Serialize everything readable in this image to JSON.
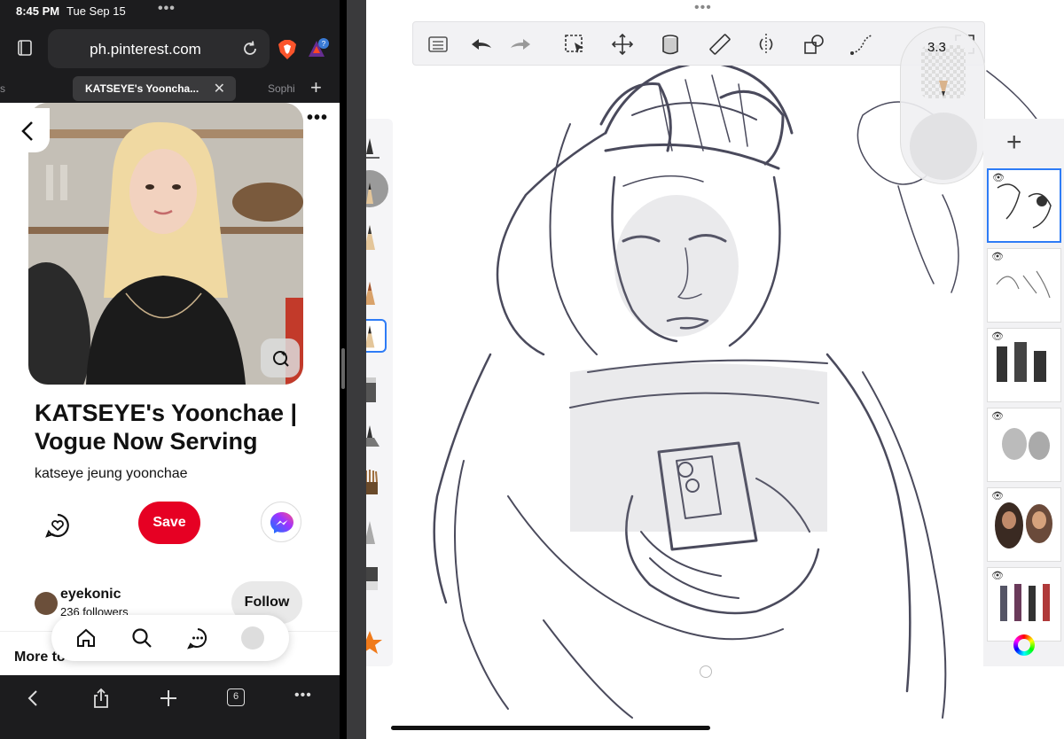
{
  "status_bar": {
    "time": "8:45 PM",
    "date": "Tue Sep 15"
  },
  "browser": {
    "url": "ph.pinterest.com",
    "tabs": [
      {
        "label": "KATSEYE's Yooncha...",
        "active": true
      },
      {
        "label": "Sophi",
        "active": false
      }
    ],
    "bat_badge": "?",
    "tab_count": "6"
  },
  "pin": {
    "title": "KATSEYE's Yoonchae | Vogue Now Serving",
    "description": "katseye jeung yoonchae",
    "save_label": "Save",
    "creator": {
      "name": "eyekonic",
      "followers": "236 followers"
    },
    "follow_label": "Follow",
    "more_to_label": "More to"
  },
  "drawing_app": {
    "brush_size_value": "3.3",
    "layers_count_visible": 6,
    "accent_color": "#2e7cf6"
  },
  "colors": {
    "pinterest_red": "#e60023",
    "browser_dark": "#1c1c1e",
    "sketch_stroke": "#4a4a5c"
  }
}
